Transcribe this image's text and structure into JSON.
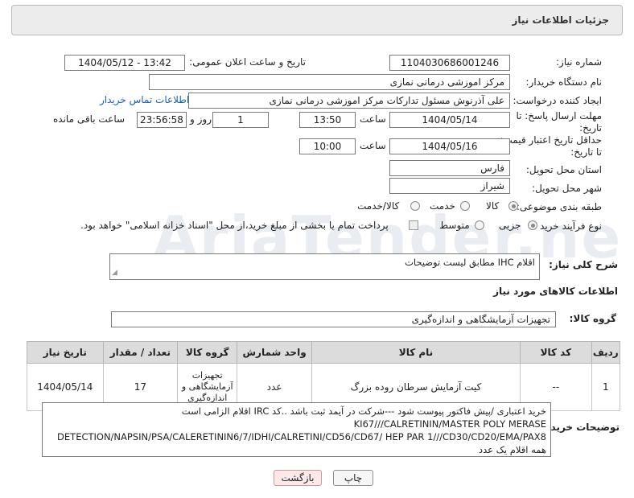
{
  "panel": {
    "title": "جزئیات اطلاعات نیاز"
  },
  "fields": {
    "need_number_label": "شماره نیاز:",
    "need_number": "1104030686001246",
    "announce_label": "تاریخ و ساعت اعلان عمومی:",
    "announce_value": "1404/05/12 - 13:42",
    "buyer_org_label": "نام دستگاه خریدار:",
    "buyer_org": "مرکز اموزشی درمانی نمازی",
    "requester_label": "ایجاد کننده درخواست:",
    "requester": "علی آذرنوش مسئول تداركات مركز اموزشی درمانی نمازی",
    "contact_link": "اطلاعات تماس خریدار",
    "deadline_label_1": "مهلت ارسال پاسخ: تا",
    "deadline_label_2": "تاریخ:",
    "deadline_date": "1404/05/14",
    "time_label": "ساعت",
    "deadline_time": "13:50",
    "days_value": "1",
    "days_label": "روز و",
    "remaining_time": "23:56:58",
    "remaining_label": "ساعت باقی مانده",
    "validity_label_1": "حداقل تاریخ اعتبار قیمت:",
    "validity_label_2": "تا تاریخ:",
    "validity_date": "1404/05/16",
    "validity_time": "10:00",
    "province_label": "استان محل تحویل:",
    "province": "فارس",
    "city_label": "شهر محل تحویل:",
    "city": "شیراز",
    "category_label": "طبقه بندی موضوعی:",
    "category_options": [
      "کالا",
      "خدمت",
      "کالا/خدمت"
    ],
    "category_selected": "کالا",
    "process_label": "نوع فرآیند خرید :",
    "process_options": [
      "جزیی",
      "متوسط"
    ],
    "process_note": "پرداخت تمام یا بخشی از مبلغ خرید،از محل \"اسناد خزانه اسلامی\" خواهد بود."
  },
  "description": {
    "label": "شرح کلی نیاز:",
    "value": "اقلام IHC مطابق لیست توضیحات"
  },
  "goods": {
    "section_title": "اطلاعات کالاهای مورد نیاز",
    "group_label": "گروه کالا:",
    "group_value": "تجهیزات آزمایشگاهی و اندازه‌گیری",
    "columns": [
      "ردیف",
      "کد کالا",
      "نام کالا",
      "واحد شمارش",
      "گروه کالا",
      "تعداد / مقدار",
      "تاریخ نیاز"
    ],
    "rows": [
      {
        "index": "1",
        "code": "--",
        "name": "کیت آزمایش سرطان روده بزرگ",
        "unit": "عدد",
        "group": "تجهیزات آزمایشگاهی و اندازه‌گیری",
        "qty": "17",
        "date": "1404/05/14"
      }
    ]
  },
  "buyer_notes": {
    "label": "توضیحات خریدار:",
    "lines": [
      "خرید اعتباری /پیش فاکتور پیوست شود ---شرکت در آیمد ثبت باشد ..کد IRC اقلام الزامی است",
      "KI67///CALRETININ/MASTER POLY MERASE",
      "DETECTION/NAPSIN/PSA/CALERETININ6/7/IDHI/CALRETINI/CD56/CD67/ HEP PAR 1///CD30/CD20/EMA/PAX8",
      "همه اقلام یک عدد"
    ]
  },
  "buttons": {
    "print": "چاپ",
    "back": "بازگشت"
  },
  "colors": {
    "link": "#1a5fb4",
    "header_bg": "#ececec",
    "table_header_bg": "#dcdcdc",
    "back_bg": "#fde9e9"
  }
}
